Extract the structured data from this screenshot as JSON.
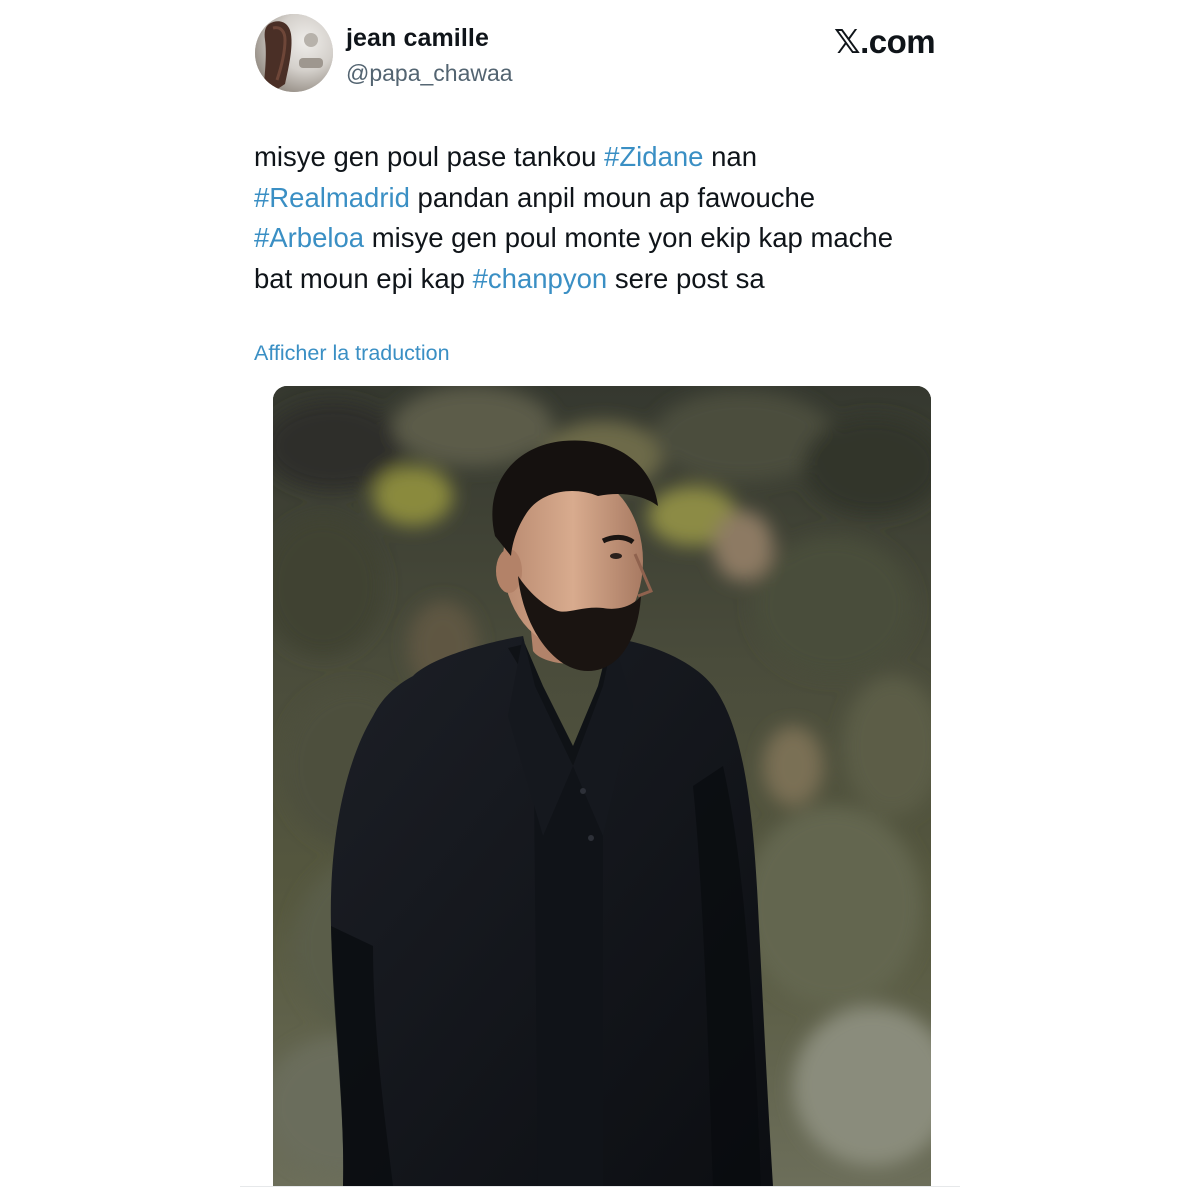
{
  "tweet": {
    "author": {
      "display_name": "jean camille",
      "handle": "@papa_chawaa"
    },
    "brand": "𝕏.com",
    "text_lines": [
      [
        {
          "text": "misye gen poul pase tankou ",
          "hashtag": false
        },
        {
          "text": "#Zidane",
          "hashtag": true
        },
        {
          "text": " nan",
          "hashtag": false
        }
      ],
      [
        {
          "text": "#Realmadrid",
          "hashtag": true
        },
        {
          "text": " pandan anpil moun ap fawouche",
          "hashtag": false
        }
      ],
      [
        {
          "text": "#Arbeloa",
          "hashtag": true
        },
        {
          "text": " misye gen poul monte yon ekip kap mache",
          "hashtag": false
        }
      ],
      [
        {
          "text": "bat moun epi kap ",
          "hashtag": false
        },
        {
          "text": "#chanpyon",
          "hashtag": true
        },
        {
          "text": " sere post sa",
          "hashtag": false
        }
      ]
    ],
    "translate_label": "Afficher la traduction",
    "media": {
      "kind": "photo",
      "subject": "coach-in-dark-suit"
    }
  },
  "colors": {
    "text": "#0f1419",
    "secondary": "#536471",
    "link": "#3a8fc4",
    "background": "#ffffff"
  },
  "icons": {
    "brand_logo": "x-logo-icon"
  }
}
